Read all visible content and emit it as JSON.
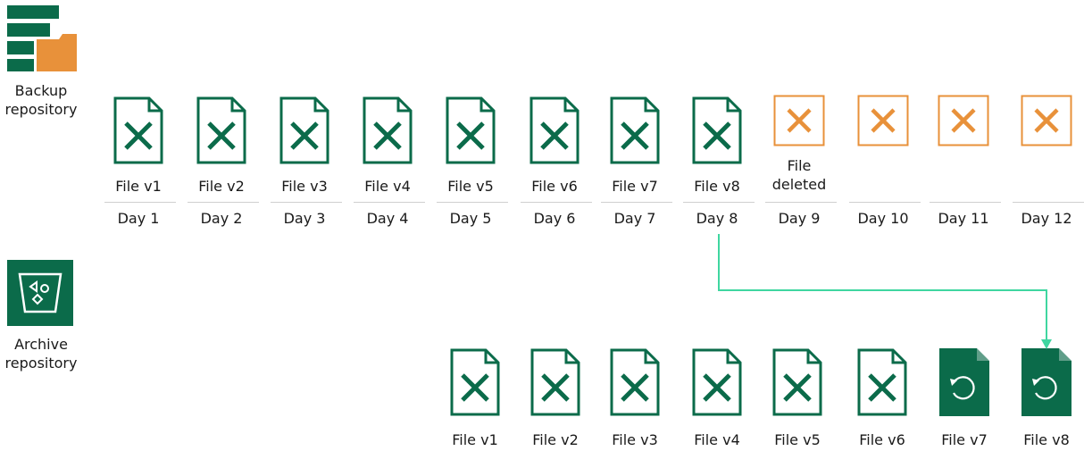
{
  "backup_repository": {
    "label": "Backup\nrepository"
  },
  "archive_repository": {
    "label": "Archive\nrepository"
  },
  "colors": {
    "green": "#0b6b4a",
    "orange": "#e8913a",
    "arrow": "#3fd6a0"
  },
  "backup_files": [
    {
      "label": "File v1",
      "status": "present"
    },
    {
      "label": "File v2",
      "status": "present"
    },
    {
      "label": "File v3",
      "status": "present"
    },
    {
      "label": "File v4",
      "status": "present"
    },
    {
      "label": "File v5",
      "status": "present"
    },
    {
      "label": "File v6",
      "status": "present"
    },
    {
      "label": "File v7",
      "status": "present"
    },
    {
      "label": "File v8",
      "status": "present"
    },
    {
      "label": "File\ndeleted",
      "status": "deleted"
    },
    {
      "label": "",
      "status": "deleted"
    },
    {
      "label": "",
      "status": "deleted"
    },
    {
      "label": "",
      "status": "deleted"
    }
  ],
  "days": [
    "Day 1",
    "Day 2",
    "Day 3",
    "Day 4",
    "Day 5",
    "Day 6",
    "Day 7",
    "Day 8",
    "Day 9",
    "Day 10",
    "Day 11",
    "Day 12"
  ],
  "archive_files": [
    {
      "label": "File v1",
      "type": "excel"
    },
    {
      "label": "File v2",
      "type": "excel"
    },
    {
      "label": "File v3",
      "type": "excel"
    },
    {
      "label": "File v4",
      "type": "excel"
    },
    {
      "label": "File v5",
      "type": "excel"
    },
    {
      "label": "File v6",
      "type": "excel"
    },
    {
      "label": "File v7",
      "type": "restore"
    },
    {
      "label": "File v8",
      "type": "restore"
    }
  ]
}
